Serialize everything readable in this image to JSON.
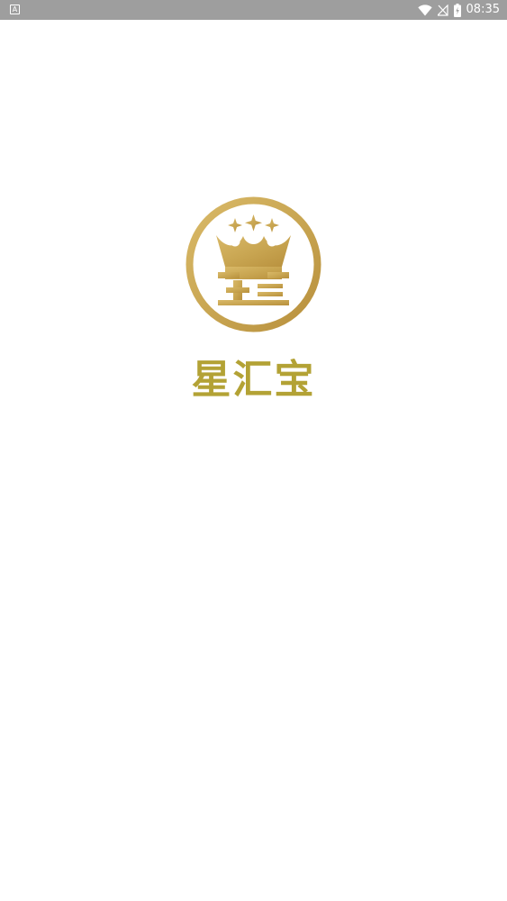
{
  "status_bar": {
    "notification_icon": "a-notification-icon",
    "notification_glyph": "A",
    "wifi_icon": "wifi-icon",
    "signal_icon": "no-signal-icon",
    "battery_icon": "battery-charging-icon",
    "time": "08:35"
  },
  "splash": {
    "logo_icon": "crown-emblem-icon",
    "app_name": "星汇宝",
    "colors": {
      "gold": "#c9a652",
      "brand_text": "#b3a235"
    }
  }
}
